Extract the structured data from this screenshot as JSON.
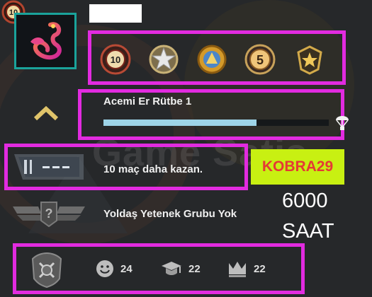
{
  "profile": {
    "level_badge": "10",
    "avatar_icon": "flamingo-icon",
    "name_redacted": true
  },
  "medals": [
    {
      "icon": "ten-year-coin-icon",
      "label": "10"
    },
    {
      "icon": "silver-star-medal-icon",
      "label": ""
    },
    {
      "icon": "gold-service-medal-icon",
      "label": ""
    },
    {
      "icon": "five-year-coin-icon",
      "label": "5"
    },
    {
      "icon": "star-crest-medal-icon",
      "label": ""
    }
  ],
  "rank": {
    "label": "Acemi Er Rütbe 1",
    "xp_fraction": 0.68,
    "reward_icon": "parachute-drop-icon"
  },
  "competitive": {
    "wins_text": "10 maç daha kazan.",
    "promo_code": "KOBRA29"
  },
  "skill_group": {
    "text": "Yoldaş Yetenek Grubu Yok",
    "unknown_mark": "?"
  },
  "hours": {
    "value": "6000",
    "unit": "SAAT"
  },
  "watermark": "Game Satis",
  "commendations": [
    {
      "name": "friendly",
      "icon": "smiley-icon",
      "count": "24"
    },
    {
      "name": "teacher",
      "icon": "graduation-cap-icon",
      "count": "22"
    },
    {
      "name": "leader",
      "icon": "crown-icon",
      "count": "22"
    }
  ],
  "colors": {
    "highlight": "#e22be0",
    "promo_bg": "#c8f012",
    "promo_text": "#e53935",
    "xp_bar": "#9ed4e8",
    "avatar_border": "#1aa39b"
  }
}
